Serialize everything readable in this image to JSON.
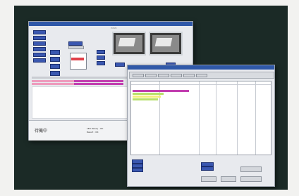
{
  "photo": {
    "background": "#1b2a26"
  },
  "left_window": {
    "status_text": "待機中",
    "footer_line1": "LED Ready : OK",
    "footer_line2": "Result : OK"
  },
  "right_window": {},
  "colors": {
    "titlebar": "#2f58a8",
    "button": "#3a57b0",
    "row_pink": "#ee9bbd",
    "row_magenta": "#c23fb0",
    "row_green": "#b7e06b",
    "row_yellow": "#f3ef7a"
  }
}
